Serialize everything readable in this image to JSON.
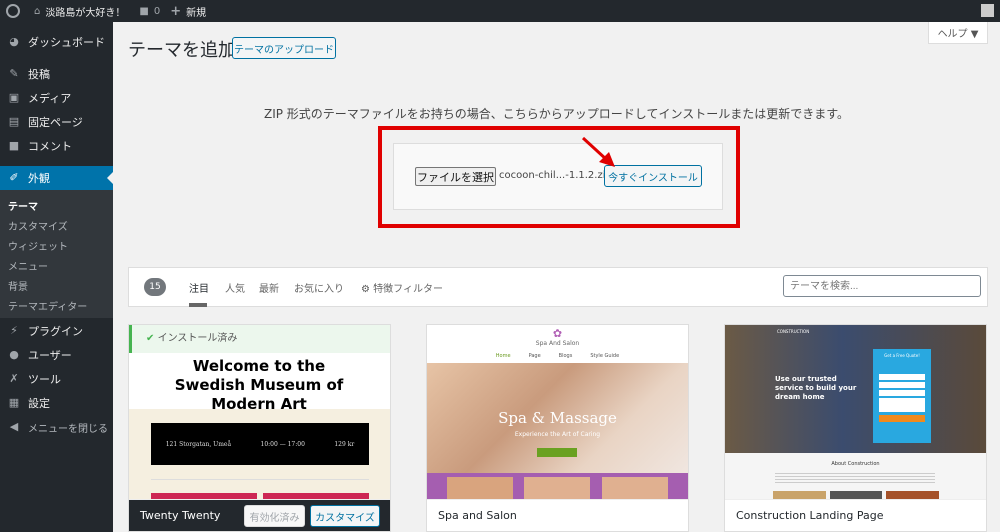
{
  "adminbar": {
    "site": "淡路島が大好き！",
    "comments": "0",
    "new": "新規",
    "icons": [
      "wordpress-icon",
      "home-icon",
      "comment-icon",
      "plus-icon",
      "avatar-icon"
    ]
  },
  "sidebar": {
    "items": [
      {
        "label": "ダッシュボード",
        "icon": "dashboard-icon"
      },
      {
        "label": "投稿",
        "icon": "pin-icon"
      },
      {
        "label": "メディア",
        "icon": "media-icon"
      },
      {
        "label": "固定ページ",
        "icon": "page-icon"
      },
      {
        "label": "コメント",
        "icon": "comment-icon"
      },
      {
        "label": "外観",
        "icon": "brush-icon",
        "active": true
      },
      {
        "label": "プラグイン",
        "icon": "plugin-icon"
      },
      {
        "label": "ユーザー",
        "icon": "user-icon"
      },
      {
        "label": "ツール",
        "icon": "wrench-icon"
      },
      {
        "label": "設定",
        "icon": "settings-icon"
      },
      {
        "label": "メニューを閉じる",
        "icon": "collapse-icon"
      }
    ],
    "submenu": [
      "テーマ",
      "カスタマイズ",
      "ウィジェット",
      "メニュー",
      "背景",
      "テーマエディター"
    ]
  },
  "header": {
    "title": "テーマを追加",
    "upload_button": "テーマのアップロード",
    "help": "ヘルプ ▼"
  },
  "upload": {
    "description": "ZIP 形式のテーマファイルをお持ちの場合、こちらからアップロードしてインストールまたは更新できます。",
    "choose_file": "ファイルを選択",
    "file_name": "cocoon-chil...-1.1.2.zip",
    "install_button": "今すぐインストール",
    "highlight_color": "#e00000"
  },
  "filter": {
    "count": "15",
    "tabs": [
      "注目",
      "人気",
      "最新",
      "お気に入り"
    ],
    "feature_filter": "特徴フィルター",
    "search_placeholder": "テーマを検索..."
  },
  "themes": [
    {
      "name": "Twenty Twenty",
      "installed": "インストール済み",
      "active_label": "有効化済み",
      "customize": "カスタマイズ",
      "preview_title": "Welcome to the Swedish Museum of Modern Art",
      "preview_info": [
        "121 Storgatan, Umeå",
        "10:00 — 17:00",
        "129 kr"
      ]
    },
    {
      "name": "Spa and Salon",
      "preview_brand": "Spa And Salon",
      "preview_headline": "Spa & Massage",
      "preview_sub": "Experience the Art of Caring",
      "preview_nav": [
        "Home",
        "Page",
        "Blogs",
        "Style Guide"
      ]
    },
    {
      "name": "Construction Landing Page",
      "preview_brand": "CONSTRUCTION",
      "preview_headline": "Use our trusted service to build your dream home",
      "preview_form": "Get a Free Quote!",
      "preview_about": "About Construction"
    }
  ]
}
